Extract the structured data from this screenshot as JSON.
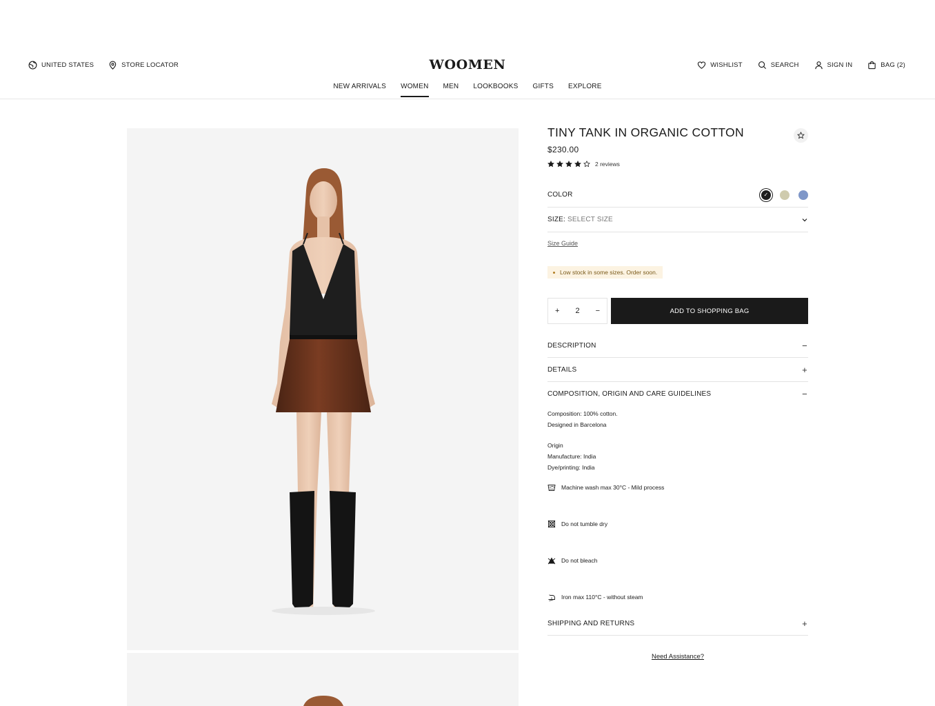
{
  "header": {
    "region": "UNITED STATES",
    "store_locator": "STORE LOCATOR",
    "logo": "WOOMEN",
    "wishlist": "WISHLIST",
    "search": "SEARCH",
    "sign_in": "SIGN IN",
    "bag": "BAG (2)"
  },
  "nav": {
    "items": [
      {
        "label": "NEW ARRIVALS"
      },
      {
        "label": "WOMEN"
      },
      {
        "label": "MEN"
      },
      {
        "label": "LOOKBOOKS"
      },
      {
        "label": "GIFTS"
      },
      {
        "label": "EXPLORE"
      }
    ],
    "active": "WOMEN"
  },
  "product": {
    "title": "TINY TANK IN ORGANIC COTTON",
    "price": "$230.00",
    "rating": 4,
    "rating_max": 5,
    "reviews": "2 reviews",
    "color_label": "COLOR",
    "colors": [
      "#1f1f1f",
      "#cfcbae",
      "#7f97c8"
    ],
    "selected_color_index": 0,
    "size_label": "SIZE:",
    "size_value": "SELECT SIZE",
    "size_guide": "Size Guide",
    "stock_notice": "Low stock in some sizes. Order soon.",
    "qty_plus": "+",
    "qty_value": "2",
    "qty_minus": "−",
    "add_to_bag": "ADD TO SHOPPING BAG"
  },
  "accordion": {
    "description": {
      "label": "DESCRIPTION",
      "sign": "−"
    },
    "details": {
      "label": "DETAILS",
      "sign": "+"
    },
    "composition": {
      "label": "COMPOSITION, ORIGIN AND CARE GUIDELINES",
      "sign": "−"
    },
    "shipping": {
      "label": "SHIPPING AND RETURNS",
      "sign": "+"
    }
  },
  "composition": {
    "line1": "Composition: 100% cotton.",
    "line2": "Designed in Barcelona",
    "origin_title": "Origin",
    "manufacture": "Manufacture: India",
    "dye": "Dye/printing: India",
    "care": [
      {
        "icon": "wash-icon",
        "text": "Machine wash max 30°C - Mild process"
      },
      {
        "icon": "no-tumble-dry-icon",
        "text": "Do not tumble dry"
      },
      {
        "icon": "no-bleach-icon",
        "text": "Do not bleach"
      },
      {
        "icon": "iron-icon",
        "text": "Iron max 110°C - without steam"
      }
    ]
  },
  "assistance": "Need Assistance?",
  "colors": {
    "text": "#1a1a1a",
    "gallery_bg": "#f4f4f4",
    "button_bg": "#1a1a1a",
    "stock_bg": "#fcf3e2"
  }
}
